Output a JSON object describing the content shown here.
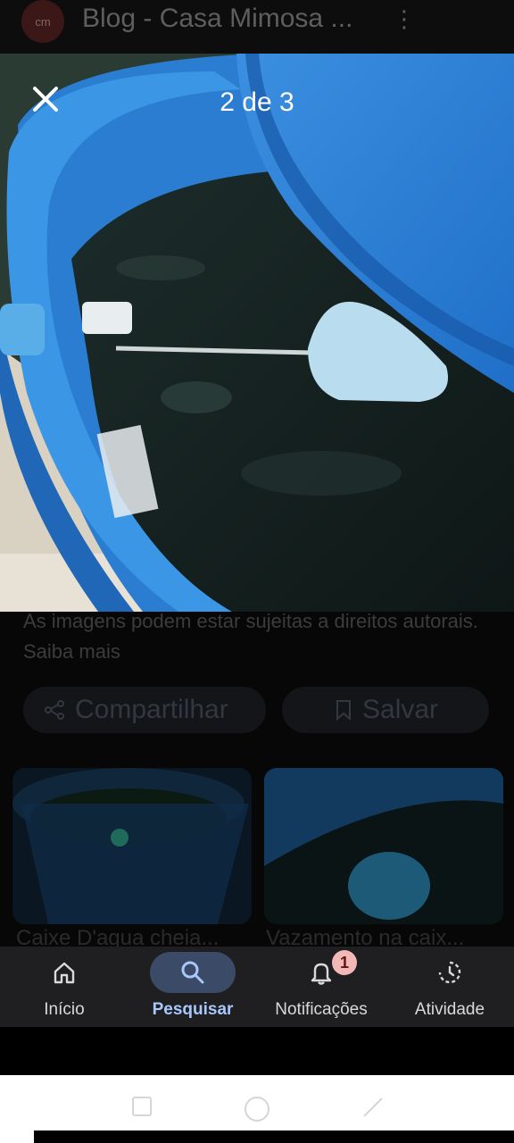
{
  "background_page": {
    "logo_text": "cm",
    "title": "Blog - Casa Mimosa ..."
  },
  "viewer": {
    "counter": "2 de 3"
  },
  "below": {
    "copyright": "As imagens podem estar sujeitas a direitos autorais. Saiba mais",
    "share_label": "Compartilhar",
    "save_label": "Salvar",
    "related": [
      {
        "caption": "Caixe D'agua cheia..."
      },
      {
        "caption": "Vazamento na caix..."
      }
    ]
  },
  "bottom_nav": {
    "items": [
      {
        "label": "Início",
        "icon": "home-icon"
      },
      {
        "label": "Pesquisar",
        "icon": "search-icon",
        "active": true
      },
      {
        "label": "Notificações",
        "icon": "bell-icon",
        "badge": "1"
      },
      {
        "label": "Atividade",
        "icon": "activity-icon"
      }
    ]
  },
  "colors": {
    "active_accent": "#a8c7fa",
    "active_pill": "#3b4a66",
    "nav_bg": "#1f1f22",
    "badge_bg": "#f2b8b5"
  }
}
